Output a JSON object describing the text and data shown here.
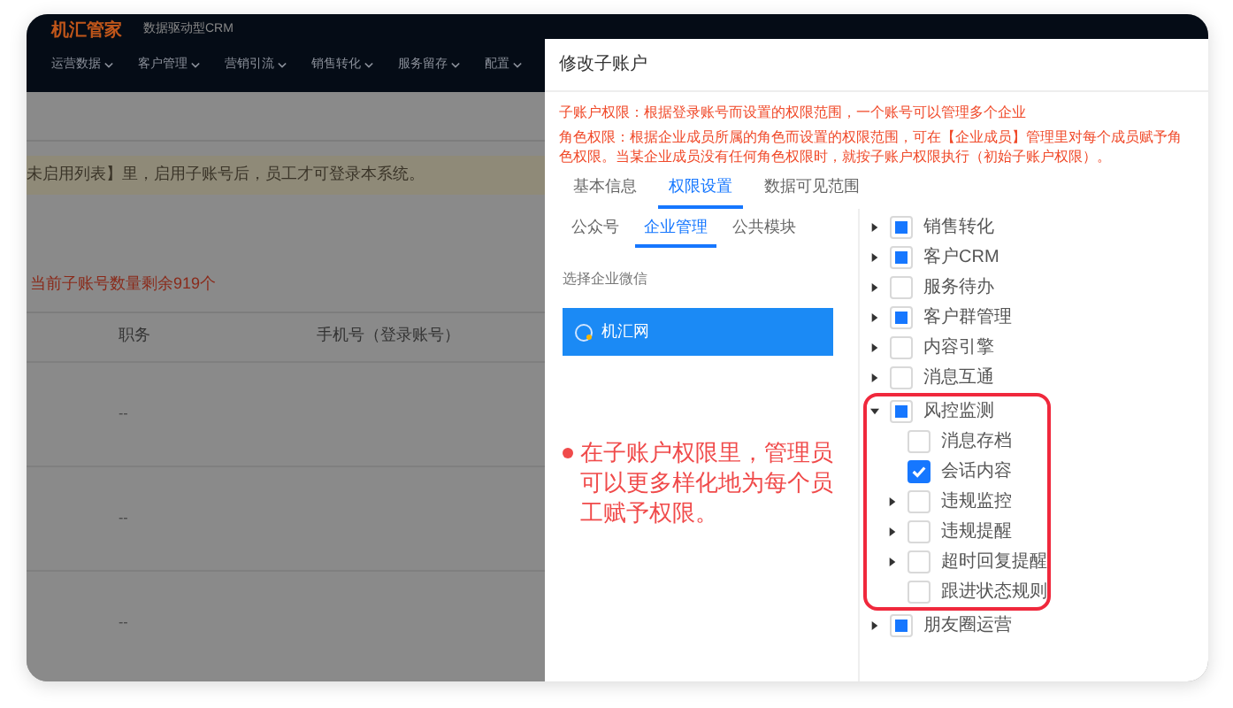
{
  "app": {
    "logo": "机汇管家",
    "subtitle": "数据驱动型CRM",
    "nav": [
      "运营数据",
      "客户管理",
      "营销引流",
      "销售转化",
      "服务留存",
      "配置"
    ]
  },
  "background": {
    "notice": "未启用列表】里，启用子账号后，员工才可登录本系统。",
    "quota": "当前子账号数量剩余919个",
    "columns": [
      "职务",
      "手机号（登录账号）"
    ],
    "rows": [
      "--",
      "--",
      "--"
    ]
  },
  "drawer": {
    "title": "修改子账户",
    "notes": [
      "子账户权限：根据登录账号而设置的权限范围，一个账号可以管理多个企业",
      "角色权限：根据企业成员所属的角色而设置的权限范围，可在【企业成员】管理里对每个成员赋予角色权限。当某企业成员没有任何角色权限时，就按子账户权限执行（初始子账户权限）。"
    ],
    "tabs": [
      {
        "label": "基本信息",
        "selected": false
      },
      {
        "label": "权限设置",
        "selected": true
      },
      {
        "label": "数据可见范围",
        "selected": false
      }
    ],
    "subtabs": [
      {
        "label": "公众号",
        "selected": false
      },
      {
        "label": "企业管理",
        "selected": true
      },
      {
        "label": "公共模块",
        "selected": false
      }
    ],
    "select_label": "选择企业微信",
    "company": {
      "name": "机汇网",
      "selected": true
    },
    "annotation": "在子账户权限里，管理员可以更多样化地为每个员工赋予权限。",
    "tree": [
      {
        "label": "销售转化",
        "checked": false,
        "partial": true,
        "expanded": false
      },
      {
        "label": "客户CRM",
        "checked": false,
        "partial": true,
        "expanded": false
      },
      {
        "label": "服务待办",
        "checked": false,
        "partial": false,
        "expanded": false
      },
      {
        "label": "客户群管理",
        "checked": false,
        "partial": true,
        "expanded": false
      },
      {
        "label": "内容引擎",
        "checked": false,
        "partial": false,
        "expanded": false
      },
      {
        "label": "消息互通",
        "checked": false,
        "partial": false,
        "expanded": false
      },
      {
        "label": "风控监测",
        "checked": false,
        "partial": true,
        "expanded": true,
        "highlighted": true,
        "children": [
          {
            "label": "消息存档",
            "checked": false,
            "partial": false
          },
          {
            "label": "会话内容",
            "checked": true,
            "partial": false
          },
          {
            "label": "违规监控",
            "checked": false,
            "partial": false,
            "expanded": false
          },
          {
            "label": "违规提醒",
            "checked": false,
            "partial": false,
            "expanded": false
          },
          {
            "label": "超时回复提醒",
            "checked": false,
            "partial": false,
            "expanded": false
          },
          {
            "label": "跟进状态规则",
            "checked": false,
            "partial": false
          }
        ]
      },
      {
        "label": "朋友圈运营",
        "checked": false,
        "partial": true,
        "expanded": false
      }
    ]
  }
}
